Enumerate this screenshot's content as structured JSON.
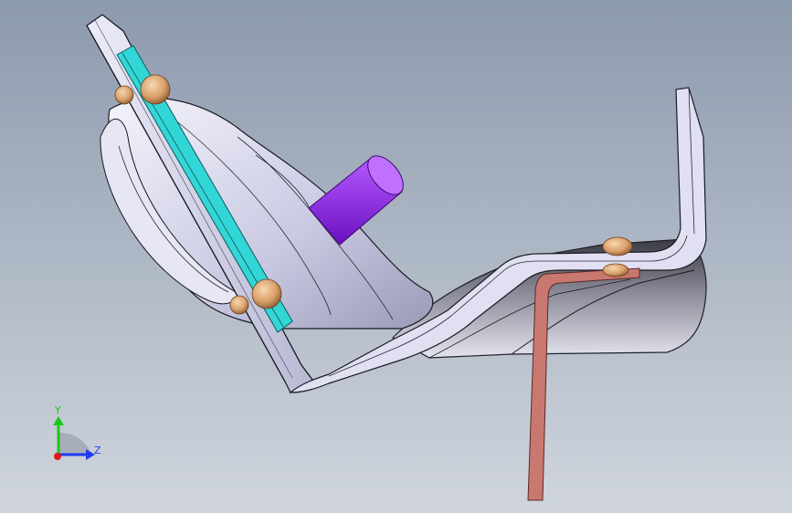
{
  "viewport": {
    "background_top": "#8c9aad",
    "background_bottom": "#d0d5dd"
  },
  "model": {
    "parts": [
      "bracket-plate",
      "mounting-strip",
      "housing-body",
      "purple-cylinder",
      "copper-strap",
      "rivet-heads"
    ],
    "colors": {
      "sheet_metal": "#dcdcf0",
      "body_dark": "#6e6e7a",
      "body_light": "#d6d6ea",
      "strip": "#33d6d6",
      "cylinder": "#9b30ff",
      "strap": "#c97870",
      "rivet": "#d9a06a"
    }
  },
  "triad": {
    "y_label": "Y",
    "z_label": "Z",
    "y_color": "#19c919",
    "z_color": "#1e3cf0",
    "x_color": "#e01818"
  }
}
